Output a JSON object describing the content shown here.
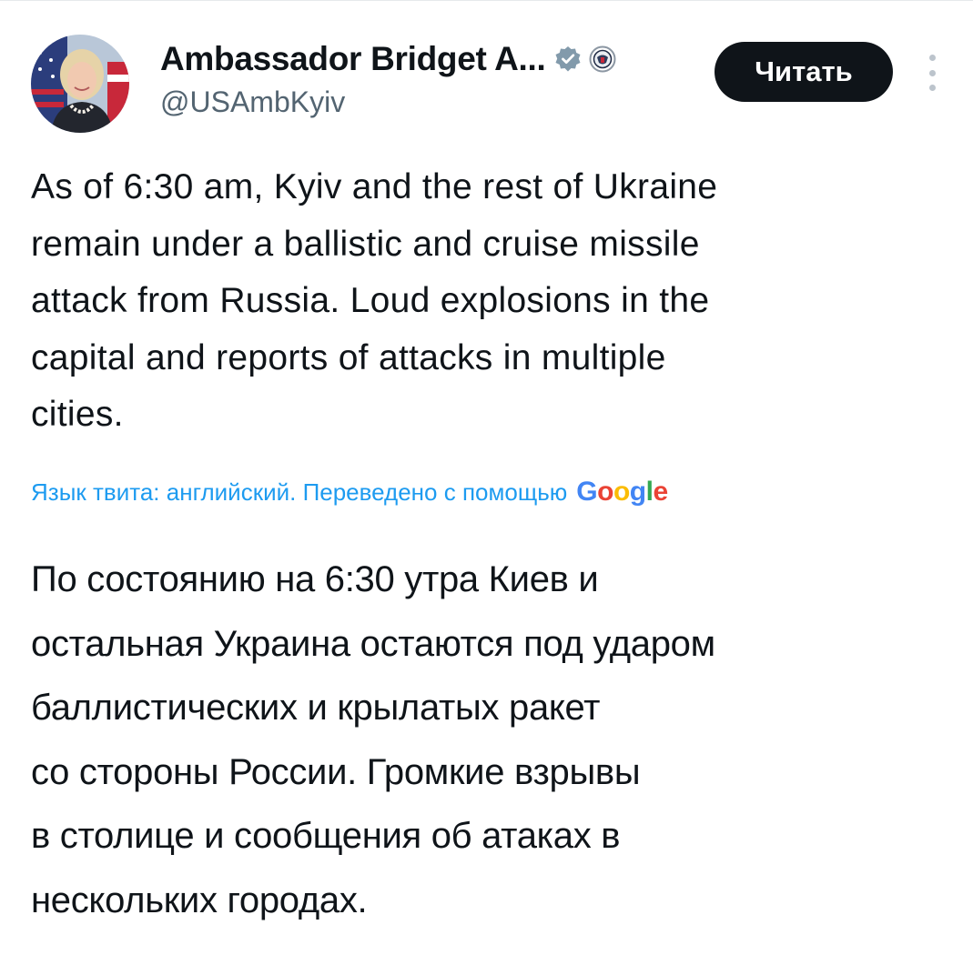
{
  "author": {
    "display_name": "Ambassador Bridget A...",
    "handle": "@USAmbKyiv",
    "avatar": "avatar-photo",
    "badges": [
      "verified-badge-icon",
      "us-embassy-seal-icon"
    ]
  },
  "follow_button": {
    "label": "Читать"
  },
  "more_menu": {
    "icon": "more-vertical-icon"
  },
  "tweet": {
    "text": "As of 6:30 am, Kyiv and the rest of Ukraine\nremain under a ballistic and cruise missile\nattack from Russia.  Loud explosions in the\ncapital and reports of attacks in multiple\ncities."
  },
  "translation": {
    "note": "Язык твита: английский. Переведено с помощью",
    "provider": {
      "letters": [
        {
          "ch": "G",
          "color": "#4285F4"
        },
        {
          "ch": "o",
          "color": "#EA4335"
        },
        {
          "ch": "o",
          "color": "#FBBC05"
        },
        {
          "ch": "g",
          "color": "#4285F4"
        },
        {
          "ch": "l",
          "color": "#34A853"
        },
        {
          "ch": "e",
          "color": "#EA4335"
        }
      ]
    },
    "text": "По состоянию на 6:30 утра Киев и\nостальная Украина остаются под ударом\nбаллистических и крылатых ракет\nсо стороны России. Громкие взрывы\nв столице и сообщения об атаках в\nнескольких городах."
  },
  "colors": {
    "link": "#1d9bf0",
    "secondary_text": "#536471",
    "button_bg": "#0f1419",
    "verified": "#829aab"
  }
}
